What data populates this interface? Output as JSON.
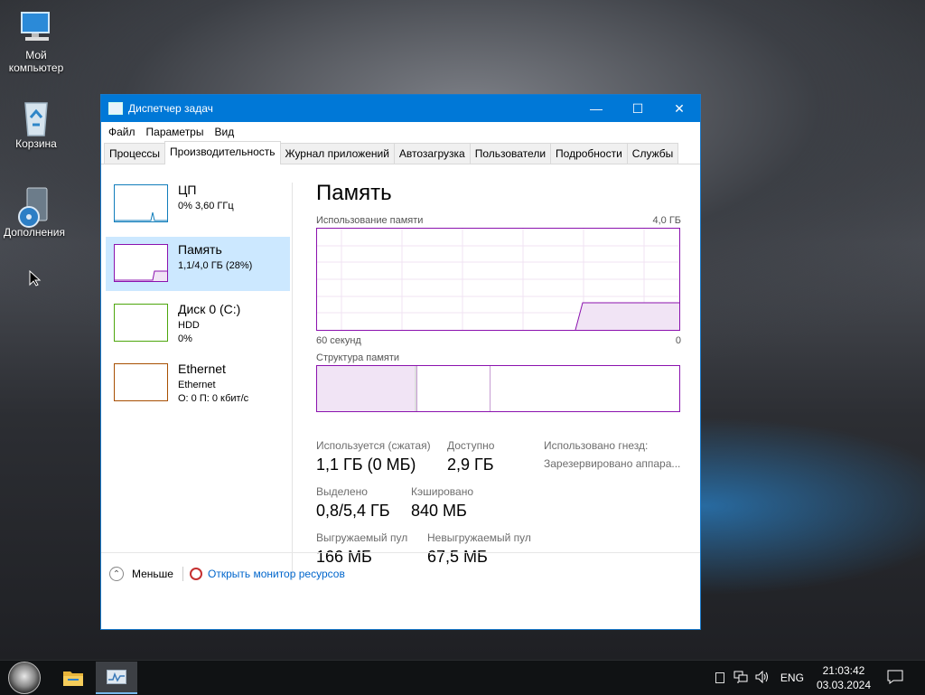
{
  "desktop": {
    "icons": [
      {
        "label1": "Мой",
        "label2": "компьютер"
      },
      {
        "label1": "Корзина",
        "label2": ""
      },
      {
        "label1": "Дополнения",
        "label2": ""
      }
    ]
  },
  "window": {
    "title": "Диспетчер задач",
    "controls": {
      "minimize": "—",
      "maximize": "☐",
      "close": "✕"
    },
    "menu": [
      "Файл",
      "Параметры",
      "Вид"
    ],
    "tabs": [
      "Процессы",
      "Производительность",
      "Журнал приложений",
      "Автозагрузка",
      "Пользователи",
      "Подробности",
      "Службы"
    ],
    "active_tab": "Производительность"
  },
  "sidebar": {
    "items": [
      {
        "name": "ЦП",
        "line1": "0% 3,60 ГГц",
        "line2": "",
        "color": "#117dbb"
      },
      {
        "name": "Память",
        "line1": "1,1/4,0 ГБ (28%)",
        "line2": "",
        "color": "#8b12ae",
        "memory_usage_fraction": 0.28
      },
      {
        "name": "Диск 0 (C:)",
        "line1": "HDD",
        "line2": "0%",
        "color": "#4da60c"
      },
      {
        "name": "Ethernet",
        "line1": "Ethernet",
        "line2": "О: 0 П: 0 кбит/с",
        "color": "#a74f01"
      }
    ]
  },
  "memory": {
    "heading": "Память",
    "usage_label": "Использование памяти",
    "usage_max": "4,0 ГБ",
    "time_left": "60 секунд",
    "time_right": "0",
    "composition_label": "Структура памяти",
    "stats": {
      "in_use_label": "Используется (сжатая)",
      "in_use_value": "1,1 ГБ (0 МБ)",
      "available_label": "Доступно",
      "available_value": "2,9 ГБ",
      "committed_label": "Выделено",
      "committed_value": "0,8/5,4 ГБ",
      "cached_label": "Кэшировано",
      "cached_value": "840 МБ",
      "paged_label": "Выгружаемый пул",
      "paged_value": "166 МБ",
      "nonpaged_label": "Невыгружаемый пул",
      "nonpaged_value": "67,5 МБ",
      "slots_label": "Использовано гнезд:",
      "reserved_label": "Зарезервировано аппара..."
    }
  },
  "footer": {
    "fewer_label": "Меньше",
    "resmon_label": "Открыть монитор ресурсов"
  },
  "taskbar": {
    "language": "ENG",
    "time": "21:03:42",
    "date": "03.03.2024"
  }
}
